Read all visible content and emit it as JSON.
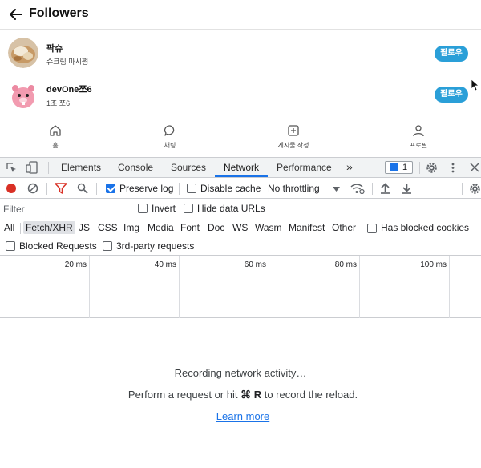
{
  "app": {
    "title": "Followers",
    "followers": [
      {
        "name": "팍슈",
        "subtitle": "슈크림 마시쩡",
        "button": "팔로우"
      },
      {
        "name": "devOne쪼6",
        "subtitle": "1조 쪼6",
        "button": "팔로우"
      }
    ],
    "nav": [
      {
        "label": "홈",
        "icon": "home-icon"
      },
      {
        "label": "채팅",
        "icon": "chat-icon"
      },
      {
        "label": "게시물 작성",
        "icon": "add-post-icon"
      },
      {
        "label": "프로필",
        "icon": "profile-icon"
      }
    ]
  },
  "devtools": {
    "tabs": [
      "Elements",
      "Console",
      "Sources",
      "Network",
      "Performance"
    ],
    "active_tab": "Network",
    "more_tabs_glyph": "»",
    "issues_count": "1",
    "toolbar": {
      "preserve_log": "Preserve log",
      "disable_cache": "Disable cache",
      "throttling": "No throttling"
    },
    "filter": {
      "placeholder": "Filter",
      "invert": "Invert",
      "hide_data_urls": "Hide data URLs",
      "types": [
        "All",
        "Fetch/XHR",
        "JS",
        "CSS",
        "Img",
        "Media",
        "Font",
        "Doc",
        "WS",
        "Wasm",
        "Manifest",
        "Other"
      ],
      "selected_type": "Fetch/XHR",
      "has_blocked_cookies": "Has blocked cookies",
      "blocked_requests": "Blocked Requests",
      "third_party": "3rd-party requests"
    },
    "timeline_ticks": [
      "20 ms",
      "40 ms",
      "60 ms",
      "80 ms",
      "100 ms"
    ],
    "empty_state": {
      "line1": "Recording network activity…",
      "line2_prefix": "Perform a request or hit ",
      "line2_shortcut": "⌘ R",
      "line2_suffix": " to record the reload.",
      "link": "Learn more"
    },
    "colors": {
      "accent": "#1a73e8",
      "record": "#d93025",
      "filter_icon": "#d93025",
      "follow_button": "#2a9fd8"
    }
  }
}
